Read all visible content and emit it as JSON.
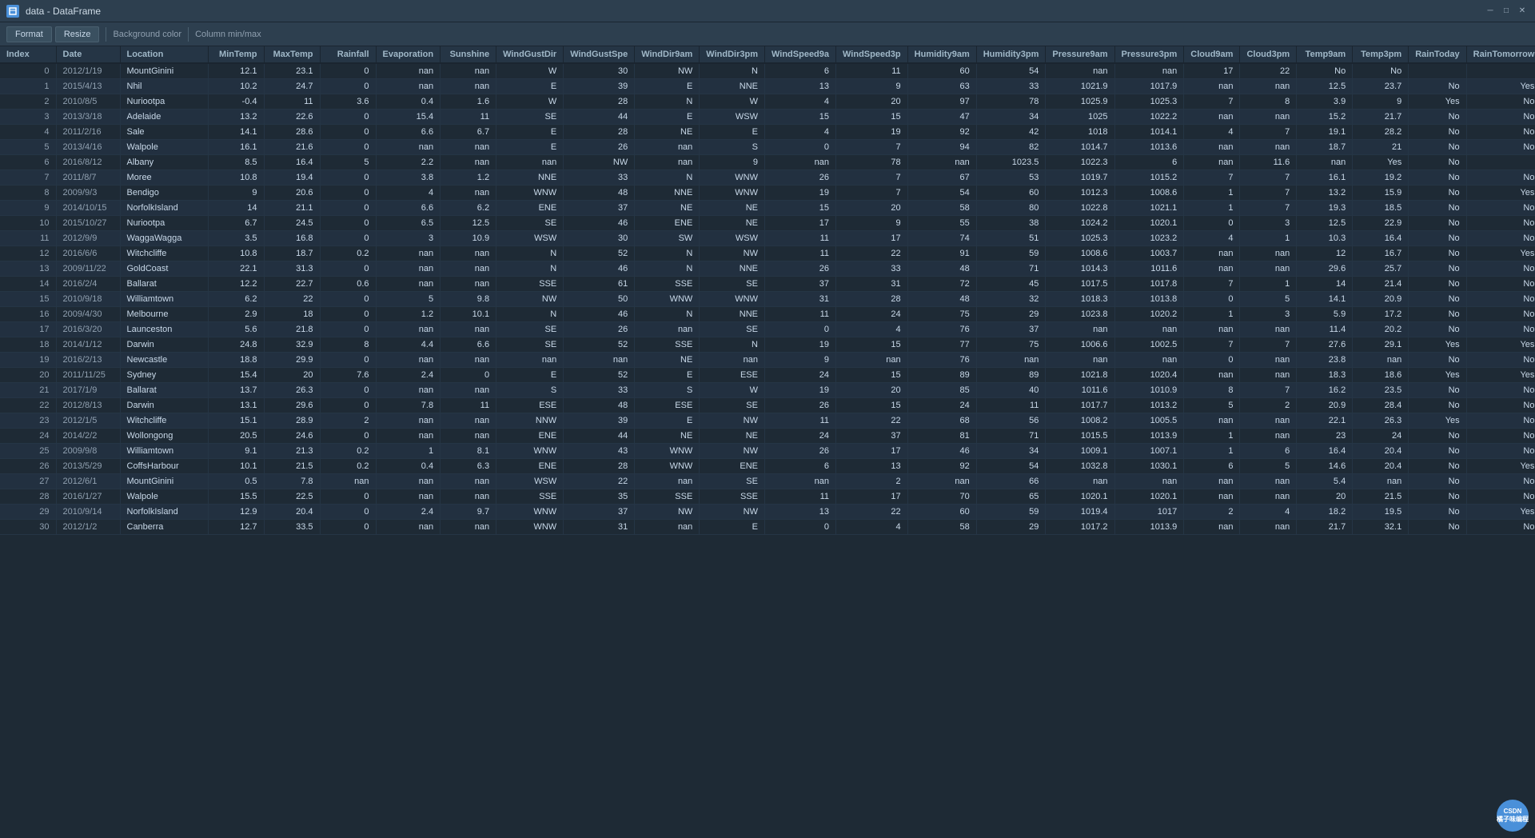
{
  "window": {
    "title": "data - DataFrame",
    "controls": [
      "minimize",
      "restore",
      "close"
    ]
  },
  "toolbar": {
    "buttons": [
      "Format",
      "Resize"
    ],
    "items": [
      "Background color",
      "Column min/max"
    ]
  },
  "table": {
    "columns": [
      "Index",
      "Date",
      "Location",
      "MinTemp",
      "MaxTemp",
      "Rainfall",
      "Evaporation",
      "Sunshine",
      "WindGustDir",
      "WindGustSpeed",
      "WindDir9am",
      "WindDir3pm",
      "WindSpeed9am",
      "WindSpeed3pm",
      "Humidity9am",
      "Humidity3pm",
      "Pressure9am",
      "Pressure3pm",
      "Cloud9am",
      "Cloud3pm",
      "Temp9am",
      "Temp3pm",
      "RainToday",
      "RainTomorrow"
    ],
    "rows": [
      [
        0,
        "2012/1/19",
        "MountGinini",
        12.1,
        23.1,
        0,
        "nan",
        "nan",
        "W",
        30,
        "NW",
        "N",
        6,
        11,
        60,
        54,
        "nan",
        "nan",
        17,
        22,
        "No",
        "No",
        "",
        ""
      ],
      [
        1,
        "2015/4/13",
        "Nhil",
        10.2,
        24.7,
        0,
        "nan",
        "nan",
        "E",
        39,
        "E",
        "NNE",
        13,
        9,
        63,
        33,
        1021.9,
        1017.9,
        "nan",
        "nan",
        12.5,
        23.7,
        "No",
        "Yes"
      ],
      [
        2,
        "2010/8/5",
        "Nuriootpa",
        -0.4,
        11,
        3.6,
        0.4,
        1.6,
        "W",
        28,
        "N",
        "W",
        4,
        20,
        97,
        78,
        1025.9,
        1025.3,
        7,
        8,
        3.9,
        9,
        "Yes",
        "No"
      ],
      [
        3,
        "2013/3/18",
        "Adelaide",
        13.2,
        22.6,
        0,
        15.4,
        11,
        "SE",
        44,
        "E",
        "WSW",
        15,
        15,
        47,
        34,
        1025,
        1022.2,
        "nan",
        "nan",
        15.2,
        21.7,
        "No",
        "No"
      ],
      [
        4,
        "2011/2/16",
        "Sale",
        14.1,
        28.6,
        0,
        6.6,
        6.7,
        "E",
        28,
        "NE",
        "E",
        4,
        19,
        92,
        42,
        1018,
        1014.1,
        4,
        7,
        19.1,
        28.2,
        "No",
        "No"
      ],
      [
        5,
        "2013/4/16",
        "Walpole",
        16.1,
        21.6,
        0,
        "nan",
        "nan",
        "E",
        26,
        "nan",
        "S",
        0,
        7,
        94,
        82,
        1014.7,
        1013.6,
        "nan",
        "nan",
        18.7,
        21,
        "No",
        "No"
      ],
      [
        6,
        "2016/8/12",
        "Albany",
        8.5,
        16.4,
        5,
        2.2,
        "nan",
        "nan",
        "NW",
        "nan",
        9,
        "nan",
        78,
        "nan",
        1023.5,
        1022.3,
        6,
        "nan",
        11.6,
        "nan",
        "Yes",
        "No"
      ],
      [
        7,
        "2011/8/7",
        "Moree",
        10.8,
        19.4,
        0,
        3.8,
        1.2,
        "NNE",
        33,
        "N",
        "WNW",
        26,
        7,
        67,
        53,
        1019.7,
        1015.2,
        7,
        7,
        16.1,
        19.2,
        "No",
        "No"
      ],
      [
        8,
        "2009/9/3",
        "Bendigo",
        9,
        20.6,
        0,
        4,
        "nan",
        "WNW",
        48,
        "NNE",
        "WNW",
        19,
        7,
        54,
        60,
        1012.3,
        1008.6,
        1,
        7,
        13.2,
        15.9,
        "No",
        "Yes"
      ],
      [
        9,
        "2014/10/15",
        "NorfolkIsland",
        14,
        21.1,
        0,
        6.6,
        6.2,
        "ENE",
        37,
        "NE",
        "NE",
        15,
        20,
        58,
        80,
        1022.8,
        1021.1,
        1,
        7,
        19.3,
        18.5,
        "No",
        "No"
      ],
      [
        10,
        "2015/10/27",
        "Nuriootpa",
        6.7,
        24.5,
        0,
        6.5,
        12.5,
        "SE",
        46,
        "ENE",
        "NE",
        17,
        9,
        55,
        38,
        1024.2,
        1020.1,
        0,
        3,
        12.5,
        22.9,
        "No",
        "No"
      ],
      [
        11,
        "2012/9/9",
        "WaggaWagga",
        3.5,
        16.8,
        0,
        3,
        10.9,
        "WSW",
        30,
        "SW",
        "WSW",
        11,
        17,
        74,
        51,
        1025.3,
        1023.2,
        4,
        1,
        10.3,
        16.4,
        "No",
        "No"
      ],
      [
        12,
        "2016/6/6",
        "Witchcliffe",
        10.8,
        18.7,
        0.2,
        "nan",
        "nan",
        "N",
        52,
        "N",
        "NW",
        11,
        22,
        91,
        59,
        1008.6,
        1003.7,
        "nan",
        "nan",
        12,
        16.7,
        "No",
        "Yes"
      ],
      [
        13,
        "2009/11/22",
        "GoldCoast",
        22.1,
        31.3,
        0,
        "nan",
        "nan",
        "N",
        46,
        "N",
        "NNE",
        26,
        33,
        48,
        71,
        1014.3,
        1011.6,
        "nan",
        "nan",
        29.6,
        25.7,
        "No",
        "No"
      ],
      [
        14,
        "2016/2/4",
        "Ballarat",
        12.2,
        22.7,
        0.6,
        "nan",
        "nan",
        "SSE",
        61,
        "SSE",
        "SE",
        37,
        31,
        72,
        45,
        1017.5,
        1017.8,
        7,
        1,
        14,
        21.4,
        "No",
        "No"
      ],
      [
        15,
        "2010/9/18",
        "Williamtown",
        6.2,
        22,
        0,
        5,
        9.8,
        "NW",
        50,
        "WNW",
        "WNW",
        31,
        28,
        48,
        32,
        1018.3,
        1013.8,
        0,
        5,
        14.1,
        20.9,
        "No",
        "No"
      ],
      [
        16,
        "2009/4/30",
        "Melbourne",
        2.9,
        18,
        0,
        1.2,
        10.1,
        "N",
        46,
        "N",
        "NNE",
        11,
        24,
        75,
        29,
        1023.8,
        1020.2,
        1,
        3,
        5.9,
        17.2,
        "No",
        "No"
      ],
      [
        17,
        "2016/3/20",
        "Launceston",
        5.6,
        21.8,
        0,
        "nan",
        "nan",
        "SE",
        26,
        "nan",
        "SE",
        0,
        4,
        76,
        37,
        "nan",
        "nan",
        "nan",
        "nan",
        11.4,
        20.2,
        "No",
        "No"
      ],
      [
        18,
        "2014/1/12",
        "Darwin",
        24.8,
        32.9,
        8,
        4.4,
        6.6,
        "SE",
        52,
        "SSE",
        "N",
        19,
        15,
        77,
        75,
        1006.6,
        1002.5,
        7,
        7,
        27.6,
        29.1,
        "Yes",
        "Yes"
      ],
      [
        19,
        "2016/2/13",
        "Newcastle",
        18.8,
        29.9,
        0,
        "nan",
        "nan",
        "nan",
        "nan",
        "NE",
        "nan",
        9,
        "nan",
        76,
        "nan",
        "nan",
        "nan",
        0,
        "nan",
        23.8,
        "nan",
        "No",
        "No"
      ],
      [
        20,
        "2011/11/25",
        "Sydney",
        15.4,
        20,
        7.6,
        2.4,
        0,
        "E",
        52,
        "E",
        "ESE",
        24,
        15,
        89,
        89,
        1021.8,
        1020.4,
        "nan",
        "nan",
        18.3,
        18.6,
        "Yes",
        "Yes"
      ],
      [
        21,
        "2017/1/9",
        "Ballarat",
        13.7,
        26.3,
        0,
        "nan",
        "nan",
        "S",
        33,
        "S",
        "W",
        19,
        20,
        85,
        40,
        1011.6,
        1010.9,
        8,
        7,
        16.2,
        23.5,
        "No",
        "No"
      ],
      [
        22,
        "2012/8/13",
        "Darwin",
        13.1,
        29.6,
        0,
        7.8,
        11,
        "ESE",
        48,
        "ESE",
        "SE",
        26,
        15,
        24,
        11,
        1017.7,
        1013.2,
        5,
        2,
        20.9,
        28.4,
        "No",
        "No"
      ],
      [
        23,
        "2012/1/5",
        "Witchcliffe",
        15.1,
        28.9,
        2,
        "nan",
        "nan",
        "NNW",
        39,
        "E",
        "NW",
        11,
        22,
        68,
        56,
        1008.2,
        1005.5,
        "nan",
        "nan",
        22.1,
        26.3,
        "Yes",
        "No"
      ],
      [
        24,
        "2014/2/2",
        "Wollongong",
        20.5,
        24.6,
        0,
        "nan",
        "nan",
        "ENE",
        44,
        "NE",
        "NE",
        24,
        37,
        81,
        71,
        1015.5,
        1013.9,
        1,
        "nan",
        23,
        24,
        "No",
        "No"
      ],
      [
        25,
        "2009/9/8",
        "Williamtown",
        9.1,
        21.3,
        0.2,
        1,
        8.1,
        "WNW",
        43,
        "WNW",
        "NW",
        26,
        17,
        46,
        34,
        1009.1,
        1007.1,
        1,
        6,
        16.4,
        20.4,
        "No",
        "No"
      ],
      [
        26,
        "2013/5/29",
        "CoffsHarbour",
        10.1,
        21.5,
        0.2,
        0.4,
        6.3,
        "ENE",
        28,
        "WNW",
        "ENE",
        6,
        13,
        92,
        54,
        1032.8,
        1030.1,
        6,
        5,
        14.6,
        20.4,
        "No",
        "Yes"
      ],
      [
        27,
        "2012/6/1",
        "MountGinini",
        0.5,
        7.8,
        "nan",
        "nan",
        "nan",
        "WSW",
        22,
        "nan",
        "SE",
        "nan",
        2,
        "nan",
        66,
        "nan",
        "nan",
        "nan",
        "nan",
        5.4,
        "nan",
        "No",
        "No"
      ],
      [
        28,
        "2016/1/27",
        "Walpole",
        15.5,
        22.5,
        0,
        "nan",
        "nan",
        "SSE",
        35,
        "SSE",
        "SSE",
        11,
        17,
        70,
        65,
        1020.1,
        1020.1,
        "nan",
        "nan",
        20,
        21.5,
        "No",
        "No"
      ],
      [
        29,
        "2010/9/14",
        "NorfolkIsland",
        12.9,
        20.4,
        0,
        2.4,
        9.7,
        "WNW",
        37,
        "NW",
        "NW",
        13,
        22,
        60,
        59,
        1019.4,
        1017,
        2,
        4,
        18.2,
        19.5,
        "No",
        "Yes"
      ],
      [
        30,
        "2012/1/2",
        "Canberra",
        12.7,
        33.5,
        0,
        "nan",
        "nan",
        "WNW",
        31,
        "nan",
        "E",
        0,
        4,
        58,
        29,
        1017.2,
        1013.9,
        "nan",
        "nan",
        21.7,
        32.1,
        "No",
        "No"
      ]
    ]
  },
  "status": {
    "format_btn": "Format",
    "resize_btn": "Resize",
    "bg_color_label": "Background color",
    "col_minmax_label": "Column min/max"
  },
  "watermark": {
    "text": "CSDN\n橘子味编程"
  }
}
